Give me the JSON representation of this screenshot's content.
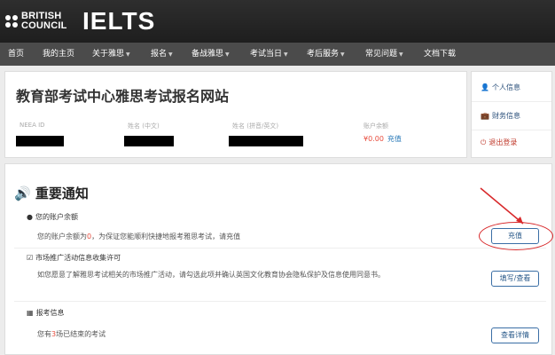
{
  "header": {
    "british_council_line1": "BRITISH",
    "british_council_line2": "COUNCIL",
    "ielts": "IELTS"
  },
  "nav": [
    {
      "label": "首页",
      "caret": false
    },
    {
      "label": "我的主页",
      "caret": false
    },
    {
      "label": "关于雅思",
      "caret": true
    },
    {
      "label": "报名",
      "caret": true
    },
    {
      "label": "备战雅思",
      "caret": true
    },
    {
      "label": "考试当日",
      "caret": true
    },
    {
      "label": "考后服务",
      "caret": true
    },
    {
      "label": "常见问题",
      "caret": true
    },
    {
      "label": "文档下载",
      "caret": false
    }
  ],
  "account": {
    "site_title": "教育部考试中心雅思考试报名网站",
    "labels": {
      "neea_id": "NEEA ID",
      "name_cn": "姓名 (中文)",
      "name_pinyin": "姓名 (拼音/英文)",
      "balance": "账户余额"
    },
    "balance_value": "¥0.00",
    "recharge_link": "充值"
  },
  "side_menu": {
    "profile": "个人信息",
    "finance": "财务信息",
    "logout": "退出登录"
  },
  "notices": {
    "heading": "重要通知",
    "balance_section": {
      "title": "您的账户余额",
      "text_prefix": "您的账户余额为",
      "amount": "0",
      "text_suffix": "，为保证您能顺利快捷地报考雅思考试，请充值",
      "button": "充值"
    },
    "marketing_section": {
      "title": "市场推广活动信息收集许可",
      "text": "如您愿意了解雅思考试相关的市场推广活动，请勾选此项并确认英国文化教育协会隐私保护及信息使用同意书。",
      "button": "填写/查看"
    },
    "exam_section": {
      "title": "报考信息",
      "text_prefix": "您有",
      "count": "3",
      "text_suffix": "场已结束的考试",
      "button": "查看详情"
    }
  },
  "colors": {
    "nav_bg": "#4b4b4b",
    "header_bg": "#2e2e2e",
    "highlight": "#e84c3d",
    "link": "#2a7ab8",
    "button_border": "#3a6ea5",
    "annotation": "#d8282a"
  }
}
